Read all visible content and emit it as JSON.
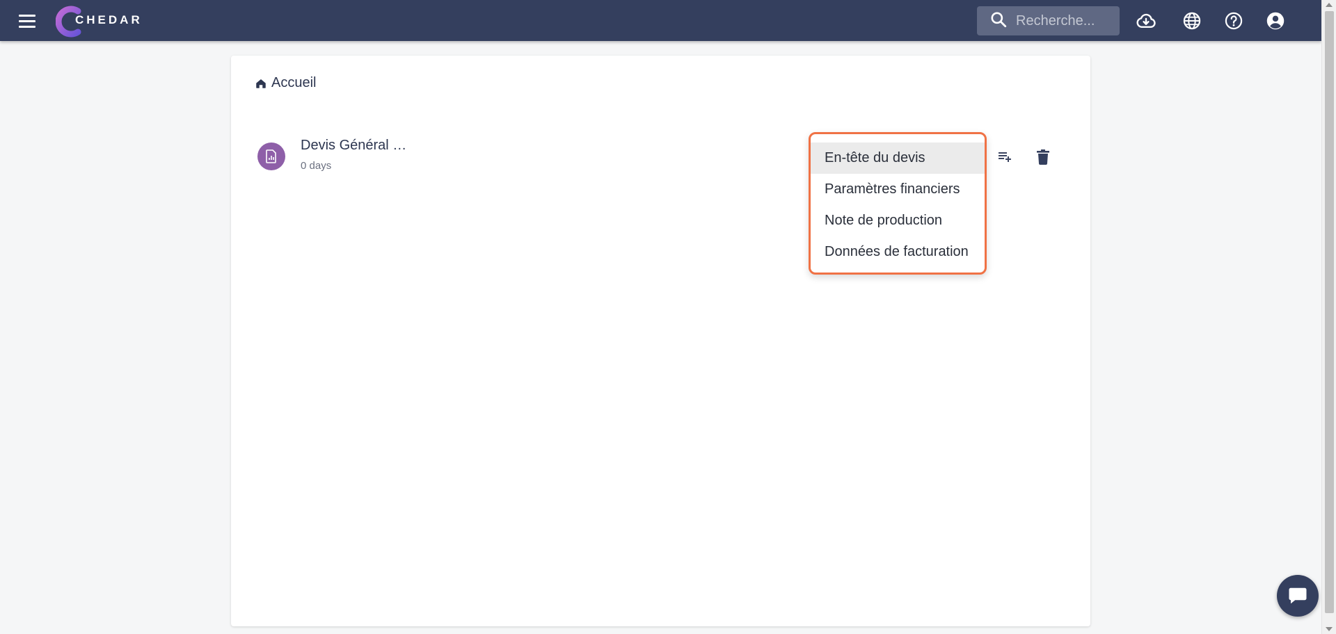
{
  "header": {
    "logo_text": "CHEDAR",
    "search_placeholder": "Recherche...",
    "icons": [
      "menu-icon",
      "cloud-download-icon",
      "globe-icon",
      "help-icon",
      "account-icon"
    ]
  },
  "breadcrumb": {
    "label": "Accueil",
    "icon": "home-icon"
  },
  "document": {
    "title": "Devis Général …",
    "subtitle": "0 days",
    "icon": "document-chart-icon",
    "avatar_color": "#8e5fa8"
  },
  "dropdown": {
    "items": [
      "En-tête du devis",
      "Paramètres financiers",
      "Note de production",
      "Données de facturation"
    ],
    "highlight_color": "#f07245"
  },
  "actions": {
    "icons": [
      "playlist-add-icon",
      "delete-icon"
    ]
  },
  "colors": {
    "header_bg": "#343f5e",
    "page_bg": "#f5f6f7"
  }
}
